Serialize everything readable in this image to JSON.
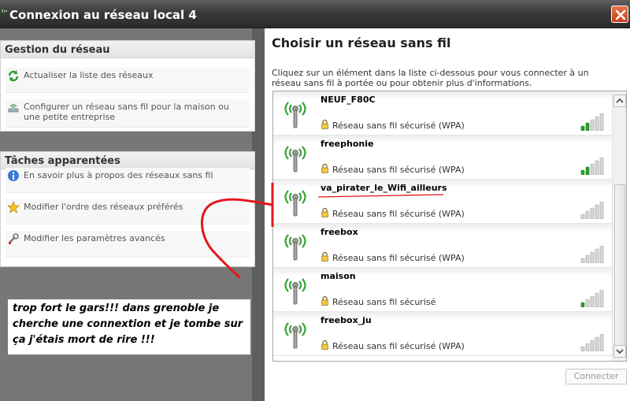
{
  "window": {
    "title": "Connexion au réseau local 4"
  },
  "left": {
    "network_tasks": {
      "header": "Gestion du réseau",
      "items": [
        {
          "label": "Actualiser la liste des réseaux",
          "icon": "refresh-icon"
        },
        {
          "label": "Configurer un réseau sans fil pour la maison ou une petite entreprise",
          "icon": "wireless-setup-icon"
        }
      ]
    },
    "related_tasks": {
      "header": "Tâches apparentées",
      "items": [
        {
          "label": "En savoir plus à propos des réseaux sans fil",
          "icon": "info-icon"
        },
        {
          "label": "Modifier l'ordre des réseaux préférés",
          "icon": "star-icon"
        },
        {
          "label": "Modifier les paramètres avancés",
          "icon": "settings-icon"
        }
      ]
    },
    "caption": "trop fort le gars!!! dans grenoble je cherche une connextion et je tombe sur ça j'étais mort de rire !!!"
  },
  "main": {
    "title": "Choisir un réseau sans fil",
    "description": "Cliquez sur un élément dans la liste ci-dessous pour vous connecter à un réseau sans fil à portée ou pour obtenir plus d'informations.",
    "networks": [
      {
        "ssid": "NEUF_F80C",
        "security": "Réseau sans fil sécurisé (WPA)",
        "signal_bars": 2
      },
      {
        "ssid": "freephonie",
        "security": "Réseau sans fil sécurisé (WPA)",
        "signal_bars": 2
      },
      {
        "ssid": "va_pirater_le_Wifi_ailleurs",
        "security": "Réseau sans fil sécurisé (WPA)",
        "signal_bars": 0
      },
      {
        "ssid": "freebox",
        "security": "Réseau sans fil sécurisé (WPA)",
        "signal_bars": 0
      },
      {
        "ssid": "maison",
        "security": "Réseau sans fil sécurisé",
        "signal_bars": 1
      },
      {
        "ssid": "freebox_ju",
        "security": "Réseau sans fil sécurisé (WPA)",
        "signal_bars": 0
      }
    ],
    "connect_label": "Connecter"
  },
  "colors": {
    "signal_on": "#2aa12a",
    "signal_off": "#d9d9d9",
    "annotation": "#e3171d",
    "title_text": "#ffffff"
  }
}
